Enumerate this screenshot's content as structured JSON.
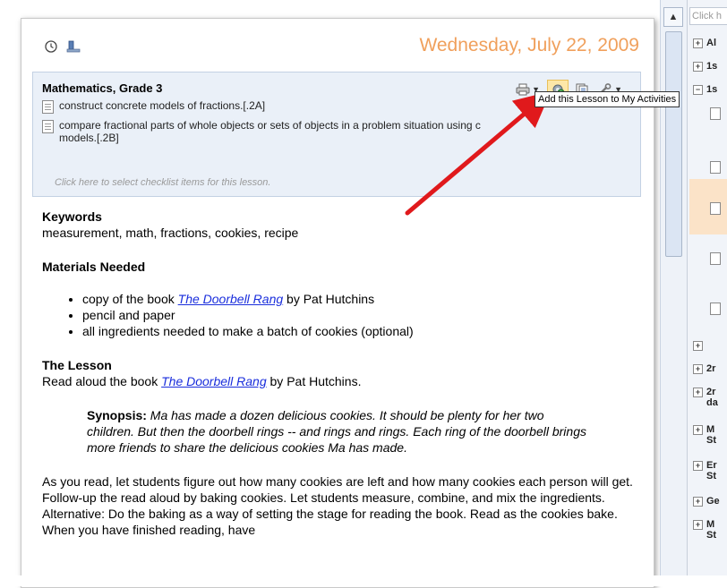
{
  "date": "Wednesday, July 22, 2009",
  "top_icons": [
    "clock-icon",
    "computer-icon"
  ],
  "subject": "Mathematics, Grade 3",
  "toolbar": {
    "tooltip": "Add this Lesson to My Activities",
    "buttons": [
      "printer-icon",
      "add-activity-icon",
      "copy-icon",
      "wrench-icon"
    ]
  },
  "checklist": {
    "items": [
      "construct concrete models of fractions.[.2A]",
      "compare fractional parts of whole objects or sets of objects in a problem situation using c",
      "models.[.2B]"
    ],
    "hint": "Click here to select checklist items for this lesson."
  },
  "content": {
    "keywords_heading": "Keywords",
    "keywords": "measurement, math, fractions, cookies, recipe",
    "materials_heading": "Materials Needed",
    "materials": [
      {
        "pre": "copy of the book ",
        "link": "The Doorbell Rang",
        "post": " by Pat Hutchins"
      },
      {
        "text": "pencil and paper"
      },
      {
        "text": "all ingredients needed to make a batch of cookies (optional)"
      }
    ],
    "lesson_heading": "The Lesson",
    "lesson_pre": "Read aloud the book ",
    "lesson_link": "The Doorbell Rang",
    "lesson_post": " by Pat Hutchins.",
    "synopsis_label": "Synopsis:",
    "synopsis_text": " Ma has made a dozen delicious cookies. It should be plenty for her two children. But then the doorbell rings -- and rings and rings. Each ring of the doorbell brings more friends to share the delicious cookies Ma has made.",
    "paragraph": "As you read, let students figure out how many cookies are left and how many cookies each person will get.  Follow-up the read aloud by baking cookies. Let students measure, combine, and mix the ingredients. Alternative: Do the baking as a way of setting the stage for reading the book. Read as the cookies bake. When you have finished reading, have"
  },
  "right_panel": {
    "search": "Click h",
    "items": [
      {
        "sign": "+",
        "label": "Al"
      },
      {
        "sign": "+",
        "label": "1s"
      },
      {
        "sign": "−",
        "label": "1s"
      },
      {
        "sign": "+",
        "label": "2r"
      },
      {
        "sign": "+",
        "label": "2r da"
      },
      {
        "sign": "+",
        "label": "M St"
      },
      {
        "sign": "+",
        "label": "Er St"
      },
      {
        "sign": "+",
        "label": "Ge"
      },
      {
        "sign": "+",
        "label": "M St"
      }
    ]
  }
}
